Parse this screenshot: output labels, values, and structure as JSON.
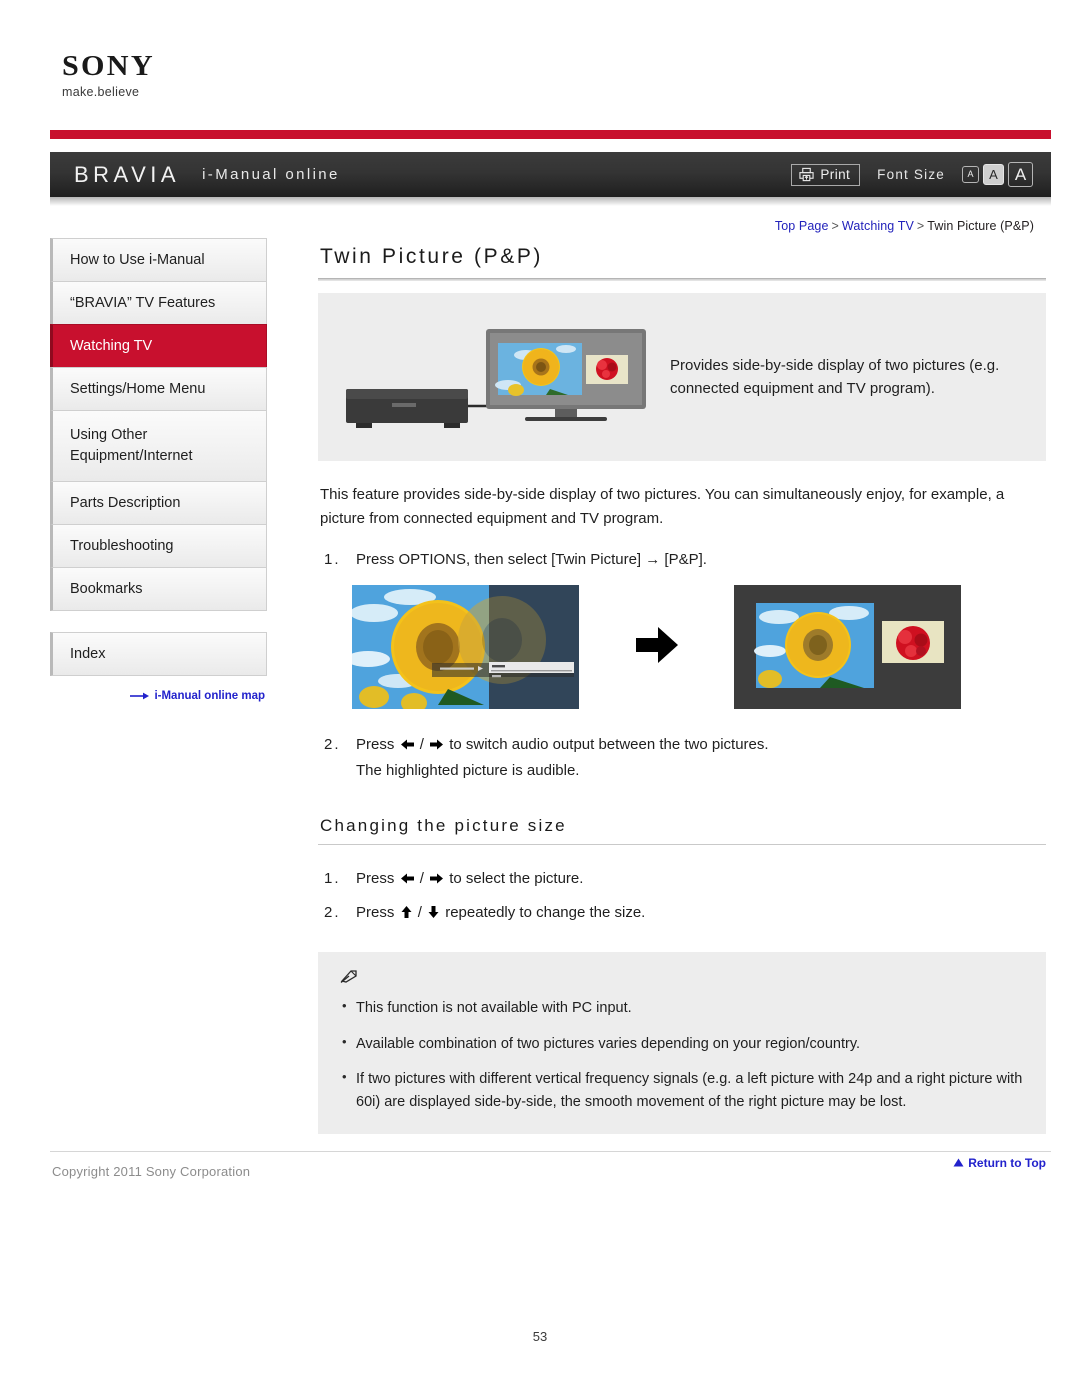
{
  "brand": {
    "logo_text": "SONY",
    "tagline": "make.believe"
  },
  "header": {
    "product": "BRAVIA",
    "title": "i-Manual online",
    "print_label": "Print",
    "print_icon": "printer-icon",
    "font_size_label": "Font Size",
    "font_size_options": [
      "A",
      "A",
      "A"
    ],
    "font_size_selected_index": 1,
    "bar_color": "#c8102e",
    "background": "#343434"
  },
  "breadcrumb": {
    "items": [
      "Top Page",
      "Watching TV",
      "Twin Picture (P&P)"
    ],
    "separator": ">",
    "link_color": "#2222bb"
  },
  "sidebar": {
    "items": [
      {
        "label": "How to Use i-Manual",
        "active": false
      },
      {
        "label": "“BRAVIA” TV Features",
        "active": false
      },
      {
        "label": "Watching TV",
        "active": true
      },
      {
        "label": "Settings/Home Menu",
        "active": false
      },
      {
        "label": "Using Other Equipment/Internet",
        "active": false
      },
      {
        "label": "Parts Description",
        "active": false
      },
      {
        "label": "Troubleshooting",
        "active": false
      },
      {
        "label": "Bookmarks",
        "active": false
      }
    ],
    "index_item": {
      "label": "Index"
    },
    "map_link": {
      "label": "i-Manual online map",
      "icon": "arrow-right-icon"
    },
    "active_color": "#c8102e"
  },
  "main": {
    "title": "Twin Picture (P&P)",
    "intro": {
      "text": "Provides side-by-side display of two pictures (e.g. connected equipment and TV program).",
      "figure_alt": "tv-with-side-by-side-pictures-and-connected-equipment",
      "background": "#ededed"
    },
    "body_paragraph": "This feature provides side-by-side display of two pictures. You can simultaneously enjoy, for example, a picture from connected equipment and TV program.",
    "steps": [
      {
        "num": "1.",
        "text_before": "Press OPTIONS, then select [Twin Picture] → [P&P].",
        "icon": null,
        "text_after": ""
      }
    ],
    "figure_row": {
      "before_alt": "sunflower-with-twin-picture-options-menu",
      "arrow_icon": "arrow-right-bold-icon",
      "after_alt": "sunflower-and-red-flower-side-by-side"
    },
    "step2": {
      "num": "2.",
      "text_before": "Press",
      "icon_left": "left-arrow-key-icon",
      "icon_sep": "/",
      "icon_right": "right-arrow-key-icon",
      "text_after": "to switch audio output between the two pictures.",
      "line2": "The highlighted picture is audible."
    },
    "subsection": {
      "title": "Changing the picture size",
      "steps": [
        {
          "num": "1.",
          "text_before": "Press",
          "icon_left": "left-arrow-key-icon",
          "icon_right": "right-arrow-key-icon",
          "text_after": "to select the picture."
        },
        {
          "num": "2.",
          "text_before": "Press",
          "icon_left": "up-arrow-key-icon",
          "icon_right": "down-arrow-key-icon",
          "text_after": "repeatedly to change the size."
        }
      ]
    },
    "notes": {
      "icon": "note-pencil-icon",
      "items": [
        "This function is not available with PC input.",
        "Available combination of two pictures varies depending on your region/country.",
        "If two pictures with different vertical frequency signals (e.g. a left picture with 24p and a right picture with 60i) are displayed side-by-side, the smooth movement of the right picture may be lost."
      ]
    },
    "return_to_top": {
      "label": "Return to Top",
      "icon": "triangle-up-icon"
    }
  },
  "footer": {
    "copyright": "Copyright 2011 Sony Corporation",
    "page_number": "53"
  }
}
